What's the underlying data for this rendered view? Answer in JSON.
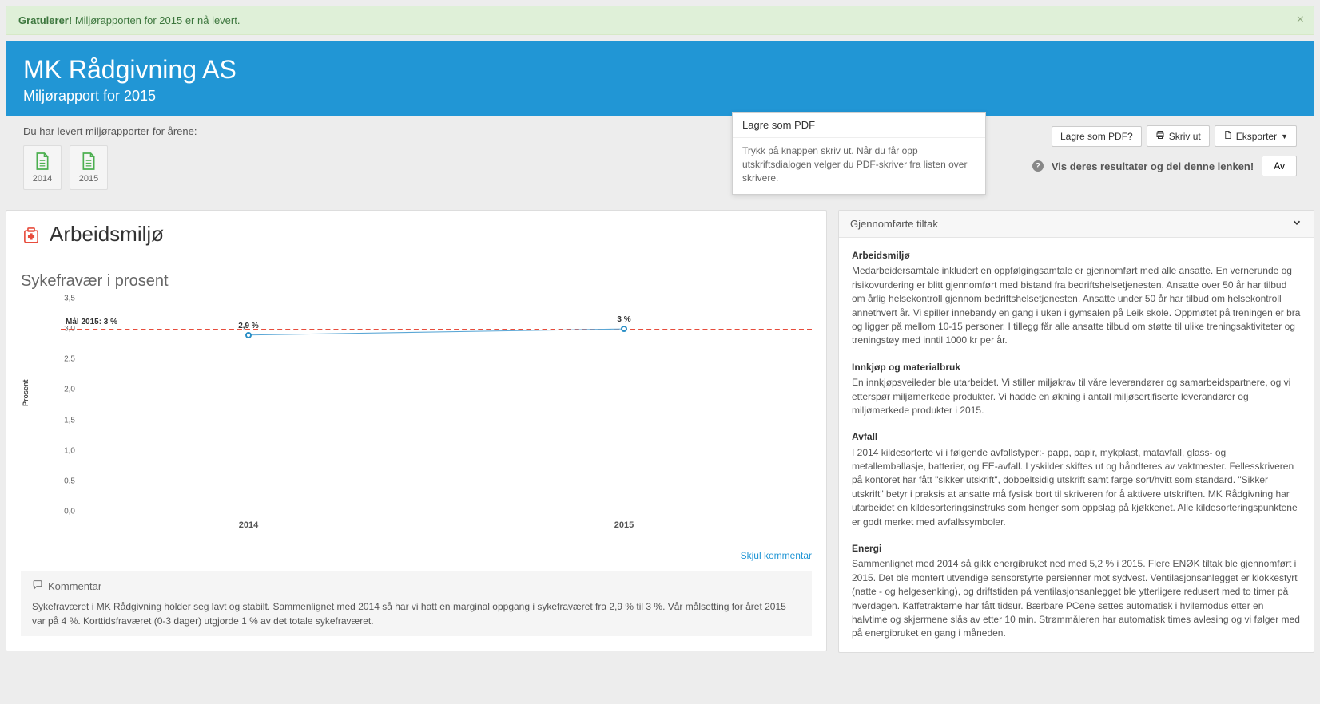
{
  "alert": {
    "strong": "Gratulerer!",
    "text": " Miljørapporten for 2015 er nå levert."
  },
  "header": {
    "title": "MK Rådgivning AS",
    "subtitle": "Miljørapport for 2015"
  },
  "years": {
    "prompt": "Du har levert miljørapporter for årene:",
    "items": [
      "2014",
      "2015"
    ]
  },
  "toolbar": {
    "save_pdf": "Lagre som PDF?",
    "print": "Skriv ut",
    "export": "Eksporter"
  },
  "share": {
    "text": "Vis deres resultater og del denne lenken!",
    "toggle": "Av"
  },
  "tooltip": {
    "title": "Lagre som PDF",
    "body": "Trykk på knappen skriv ut. Når du får opp utskriftsdialogen velger du PDF-skriver fra listen over skrivere."
  },
  "panel": {
    "title": "Arbeidsmiljø",
    "chart_title": "Sykefravær i prosent",
    "hide_comment": "Skjul kommentar",
    "comment_heading": "Kommentar",
    "comment_body": "Sykefraværet i MK Rådgivning holder seg lavt og stabilt. Sammenlignet med 2014 så har vi hatt en marginal oppgang i sykefraværet fra 2,9 % til 3 %. Vår målsetting for året 2015 var på 4 %. Korttidsfraværet (0-3 dager) utgjorde 1 % av det totale sykefraværet."
  },
  "chart_data": {
    "type": "line",
    "categories": [
      "2014",
      "2015"
    ],
    "values": [
      2.9,
      3.0
    ],
    "data_labels": [
      "2,9 %",
      "3 %"
    ],
    "reference": {
      "value": 3.0,
      "label": "Mål 2015: 3 %"
    },
    "ylabel": "Prosent",
    "xlabel": "",
    "ylim": [
      0.0,
      3.5
    ],
    "yticks": [
      "0,0",
      "0,5",
      "1,0",
      "1,5",
      "2,0",
      "2,5",
      "3,0",
      "3,5"
    ]
  },
  "right_panel": {
    "header": "Gjennomførte tiltak",
    "sections": [
      {
        "heading": "Arbeidsmiljø",
        "body": "Medarbeidersamtale inkludert en oppfølgingsamtale er gjennomført med alle ansatte. En vernerunde og risikovurdering er blitt gjennomført med bistand fra bedriftshelsetjenesten. Ansatte over 50 år har tilbud om årlig helsekontroll gjennom bedriftshelsetjenesten. Ansatte under 50 år har tilbud om helsekontroll annethvert år. Vi spiller innebandy en gang i uken i gymsalen på Leik skole. Oppmøtet på treningen er bra og ligger på mellom 10-15 personer. I tillegg får alle ansatte tilbud om støtte til ulike treningsaktiviteter og treningstøy med inntil 1000 kr per år."
      },
      {
        "heading": "Innkjøp og materialbruk",
        "body": "En innkjøpsveileder ble utarbeidet. Vi stiller miljøkrav til våre leverandører og samarbeidspartnere, og vi etterspør miljømerkede produkter. Vi hadde en økning i antall miljøsertifiserte leverandører og miljømerkede produkter i 2015."
      },
      {
        "heading": "Avfall",
        "body": "I 2014 kildesorterte vi i følgende avfallstyper:- papp, papir, mykplast, matavfall, glass- og metallemballasje, batterier, og EE-avfall. Lyskilder skiftes ut og håndteres av vaktmester. Fellesskriveren på kontoret har fått \"sikker utskrift\", dobbeltsidig utskrift samt farge sort/hvitt som standard. \"Sikker utskrift\" betyr i praksis at ansatte må fysisk bort til skriveren for å aktivere utskriften. MK Rådgivning har utarbeidet en kildesorteringsinstruks som henger som oppslag på kjøkkenet. Alle kildesorteringspunktene er godt merket med avfallssymboler."
      },
      {
        "heading": "Energi",
        "body": "Sammenlignet med 2014 så gikk energibruket ned med 5,2 % i 2015. Flere ENØK tiltak ble gjennomført i 2015. Det ble montert utvendige sensorstyrte persienner mot sydvest. Ventilasjonsanlegget er klokkestyrt (natte - og helgesenking), og driftstiden på ventilasjonsanlegget ble ytterligere redusert med to timer på hverdagen. Kaffetrakterne har fått tidsur. Bærbare PCene settes automatisk i hvilemodus etter en halvtime og skjermene slås av etter 10 min. Strømmåleren har automatisk times avlesing og vi følger med på energibruket en gang i måneden."
      }
    ]
  }
}
